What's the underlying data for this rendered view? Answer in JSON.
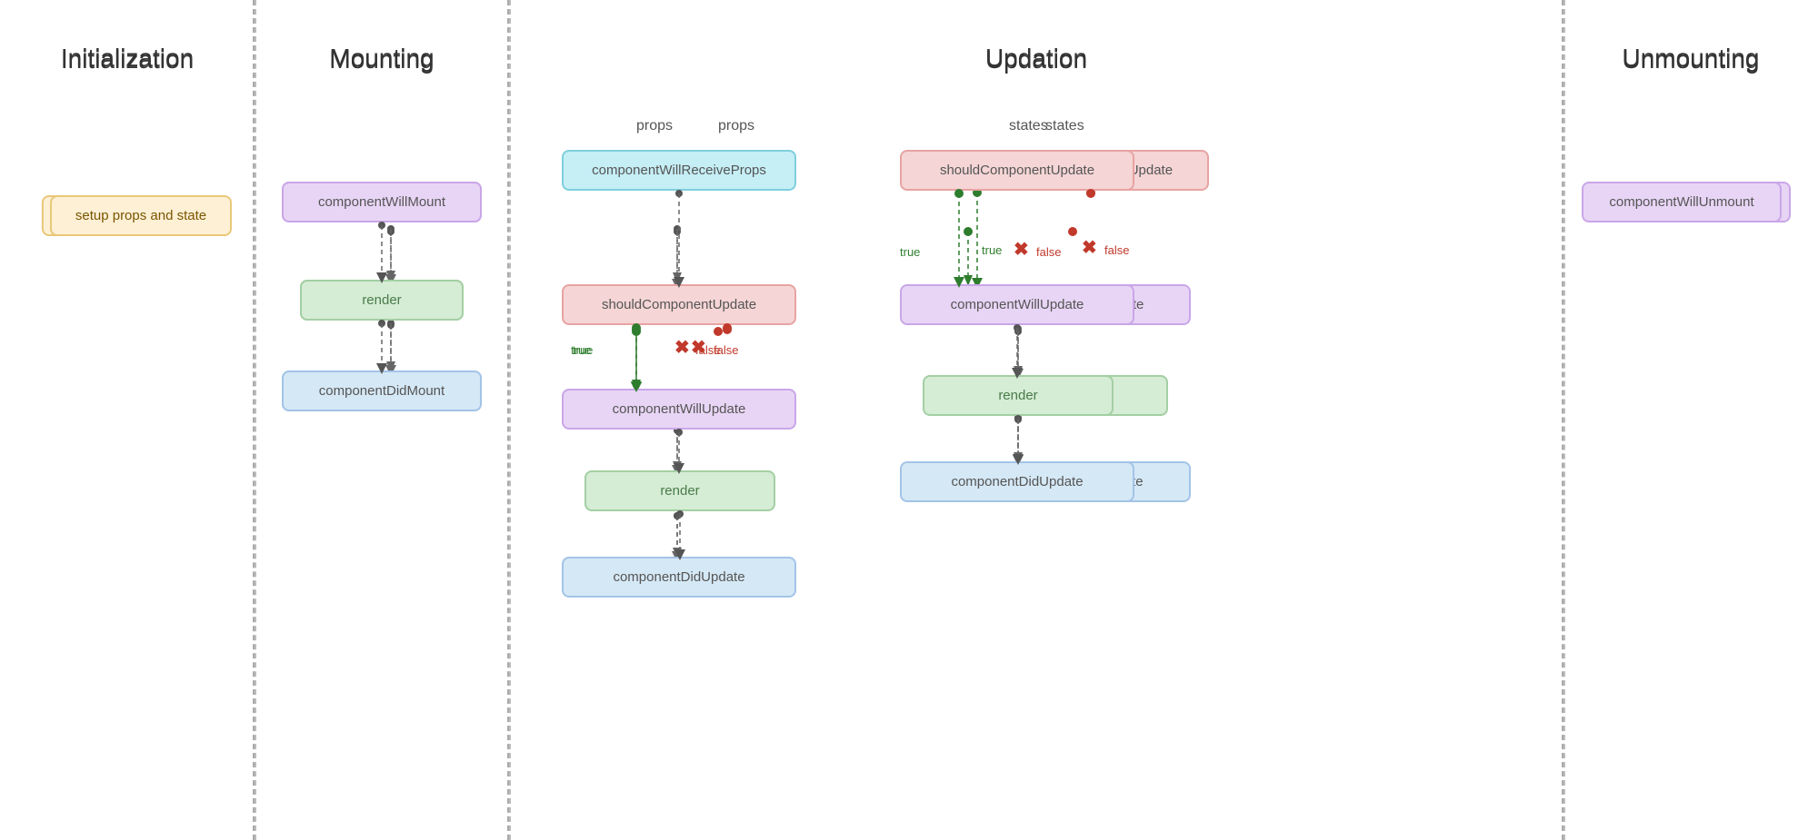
{
  "sections": {
    "init": {
      "title": "Initialization",
      "node": "setup props and state"
    },
    "mount": {
      "title": "Mounting",
      "nodes": {
        "willMount": "componentWillMount",
        "render": "render",
        "didMount": "componentDidMount"
      }
    },
    "update": {
      "title": "Updation",
      "props_label": "props",
      "states_label": "states",
      "nodes": {
        "willReceiveProps": "componentWillReceiveProps",
        "shouldUpdate_props": "shouldComponentUpdate",
        "willUpdate_props": "componentWillUpdate",
        "render_props": "render",
        "didUpdate_props": "componentDidUpdate",
        "shouldUpdate_states": "shouldComponentUpdate",
        "willUpdate_states": "componentWillUpdate",
        "render_states": "render",
        "didUpdate_states": "componentDidUpdate"
      }
    },
    "unmount": {
      "title": "Unmounting",
      "node": "componentWillUnmount"
    }
  },
  "labels": {
    "true": "true",
    "false": "false"
  }
}
